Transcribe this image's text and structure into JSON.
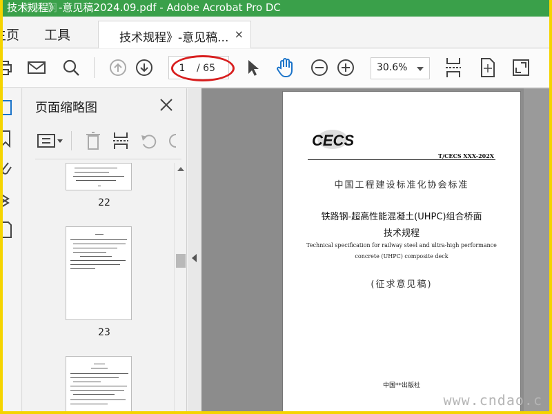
{
  "window": {
    "title": "技术规程》-意见稿2024.09.pdf - Adobe Acrobat Pro DC",
    "watermark_tl": "道格网"
  },
  "nav": {
    "home": "主页",
    "tools": "工具"
  },
  "tab": {
    "title": "技术规程》-意见稿...",
    "close": "×"
  },
  "toolbar": {
    "page_current": "1",
    "page_total": "/ 65",
    "zoom": "30.6%"
  },
  "panel": {
    "title": "页面缩略图",
    "thumbnails": [
      {
        "page": "22"
      },
      {
        "page": "23"
      }
    ]
  },
  "document": {
    "logo": "CECS",
    "std_code": "T/CECS XXX-202X",
    "association": "中国工程建设标准化协会标准",
    "title_cn_1": "铁路钢-超高性能混凝土(UHPC)组合桥面",
    "title_cn_2": "技术规程",
    "title_en_1": "Technical specification for railway steel and ultra-high performance",
    "title_en_2": "concrete (UHPC) composite deck",
    "draft": "(征求意见稿)",
    "publisher": "中国**出版社"
  },
  "watermark": "www.cndao.c",
  "colors": {
    "titlebar": "#3aa04a",
    "annotation": "#d81e1e",
    "border": "#f5d400"
  }
}
